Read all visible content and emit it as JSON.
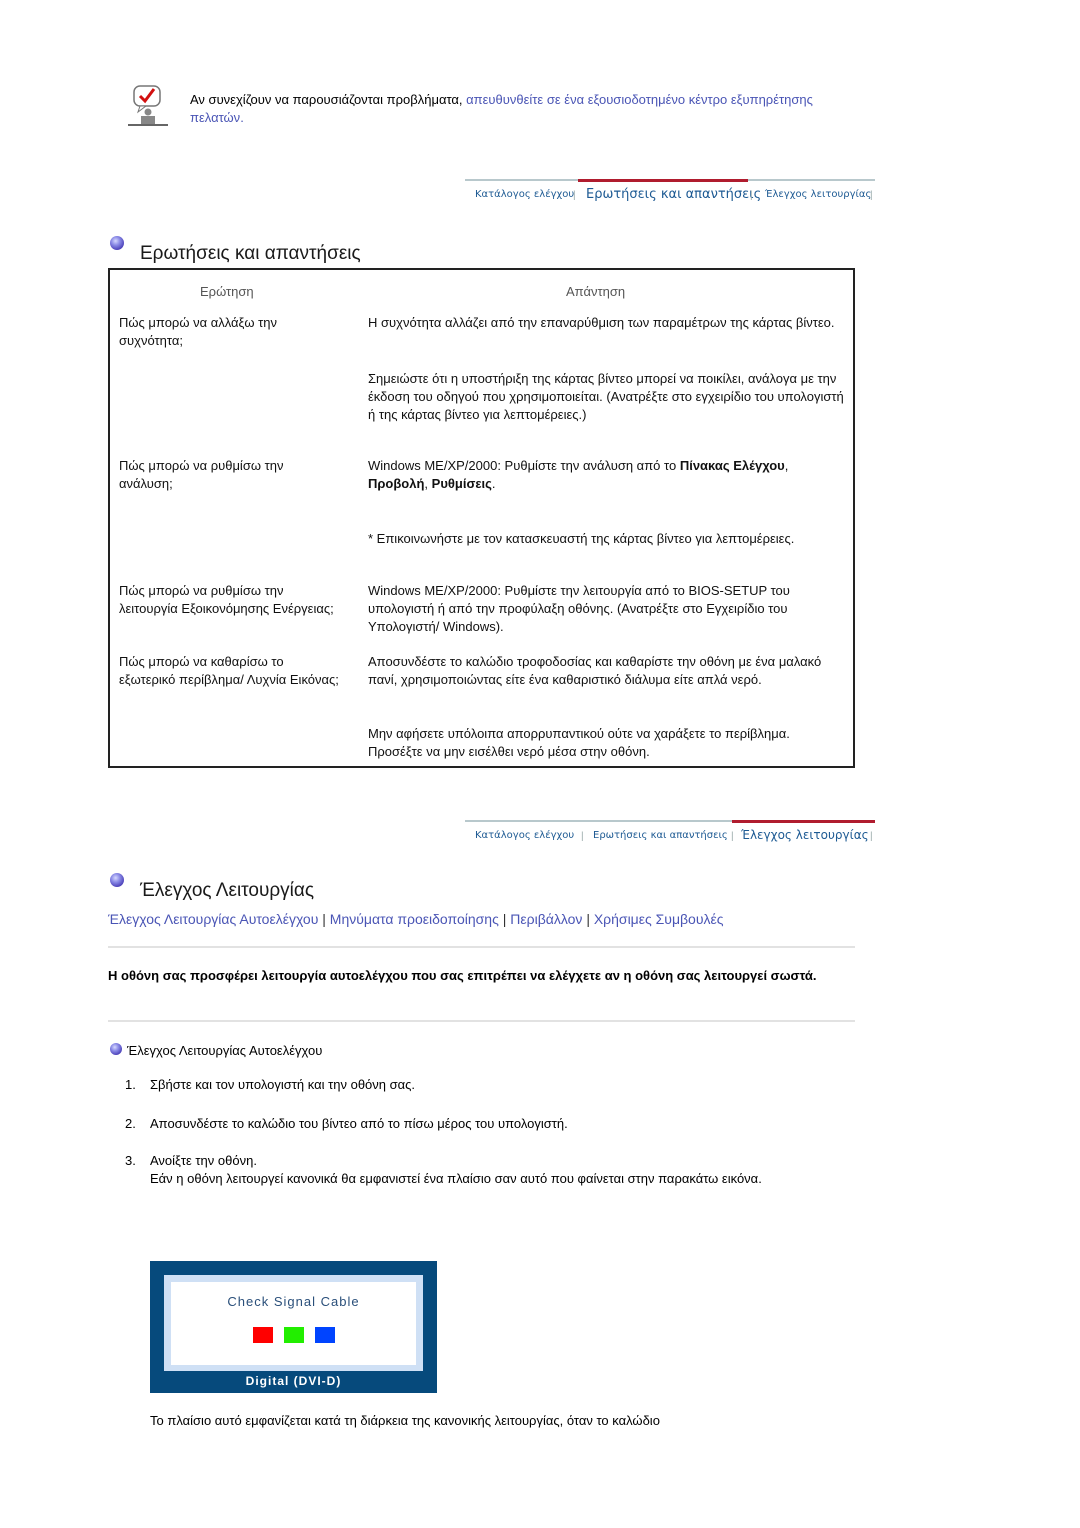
{
  "note": {
    "icon": "checklist-person-icon",
    "text_plain": "Αν συνεχίζουν να παρουσιάζονται προβλήματα, ",
    "text_link": "απευθυνθείτε σε ένα εξουσιοδοτημένο κέντρο εξυπηρέτησης πελατών",
    "text_end": "."
  },
  "tabbar1": {
    "tabs": [
      {
        "label": "Κατάλογος ελέγχου",
        "active": false
      },
      {
        "label": "Ερωτήσεις και απαντήσεις",
        "active": true
      },
      {
        "label": "Έλεγχος λειτουργίας",
        "active": false
      }
    ],
    "accent_color": "#b01c2e"
  },
  "qa_section": {
    "title": "Ερωτήσεις και απαντήσεις",
    "headers": {
      "question": "Ερώτηση",
      "answer": "Απάντηση"
    },
    "rows": [
      {
        "question": "Πώς μπορώ να αλλάξω την συχνότητα;",
        "answers": [
          "Η συχνότητα αλλάζει από την επαναρύθμιση των παραμέτρων της κάρτας βίντεο.",
          "Σημειώστε ότι η υποστήριξη της κάρτας βίντεο μπορεί να ποικίλει, ανάλογα με την έκδοση του οδηγού που χρησιμοποιείται. (Ανατρέξτε στο εγχειρίδιο του υπολογιστή ή της κάρτας βίντεο για λεπτομέρειες.)"
        ]
      },
      {
        "question": "Πώς μπορώ να ρυθμίσω την ανάλυση;",
        "answer_prefix": "Windows ME/XP/2000: Ρυθμίστε την ανάλυση από το ",
        "answer_bold1": "Πίνακας Ελέγχου",
        "answer_sep1": ", ",
        "answer_bold2": "Προβολή",
        "answer_sep2": ", ",
        "answer_bold3": "Ρυθμίσεις",
        "answer_end": ".",
        "answer_note": "* Επικοινωνήστε με τον κατασκευαστή της κάρτας βίντεο για λεπτομέρειες."
      },
      {
        "question": "Πώς μπορώ να ρυθμίσω την λειτουργία Εξοικονόμησης Ενέργειας;",
        "answers": [
          "Windows ME/XP/2000: Ρυθμίστε την λειτουργία από το BIOS-SETUP του υπολογιστή ή από την προφύλαξη οθόνης. (Ανατρέξτε στο Εγχειρίδιο του Υπολογιστή/ Windows)."
        ]
      },
      {
        "question": "Πώς μπορώ να καθαρίσω το εξωτερικό περίβλημα/ Λυχνία Εικόνας;",
        "answers": [
          "Αποσυνδέστε το καλώδιο τροφοδοσίας και καθαρίστε την οθόνη με ένα μαλακό πανί, χρησιμοποιώντας είτε ένα καθαριστικό διάλυμα είτε απλά νερό.",
          "Μην αφήσετε υπόλοιπα απορρυπαντικού ούτε να χαράξετε το περίβλημα. Προσέξτε να μην εισέλθει νερό μέσα στην οθόνη."
        ]
      }
    ]
  },
  "tabbar2": {
    "tabs": [
      {
        "label": "Κατάλογος ελέγχου",
        "active": false
      },
      {
        "label": "Ερωτήσεις και απαντήσεις",
        "active": false
      },
      {
        "label": "Έλεγχος λειτουργίας",
        "active": true
      }
    ]
  },
  "func_section": {
    "title": "Έλεγχος Λειτουργίας",
    "links": [
      "Έλεγχος Λειτουργίας Αυτοελέγχου",
      "Μηνύματα προειδοποίησης",
      "Περιβάλλον",
      "Χρήσιμες Συμβουλές"
    ],
    "link_separator": "|",
    "intro": "Η οθόνη σας προσφέρει λειτουργία αυτοελέγχου που σας επιτρέπει να ελέγχετε αν η οθόνη σας λειτουργεί σωστά.",
    "subtitle": "Έλεγχος Λειτουργίας Αυτοελέγχου",
    "steps": [
      {
        "num": "1.",
        "text": "Σβήστε και τον υπολογιστή και την οθόνη σας."
      },
      {
        "num": "2.",
        "text": "Αποσυνδέστε το καλώδιο του βίντεο από το πίσω μέρος του υπολογιστή."
      },
      {
        "num": "3.",
        "text": "Ανοίξτε την οθόνη.",
        "detail": "Εάν η οθόνη λειτουργεί κανονικά θα εμφανιστεί ένα πλαίσιο σαν αυτό που φαίνεται στην παρακάτω εικόνα."
      }
    ],
    "monitor_dialog": {
      "message": "Check Signal Cable",
      "footer": "Digital (DVI-D)",
      "squares": [
        "#ff0000",
        "#22ee00",
        "#0044ff"
      ],
      "frame_color": "#064a7c"
    },
    "trailing_text": "Το πλαίσιο αυτό εμφανίζεται κατά τη διάρκεια της κανονικής λειτουργίας, όταν το καλώδιο"
  }
}
